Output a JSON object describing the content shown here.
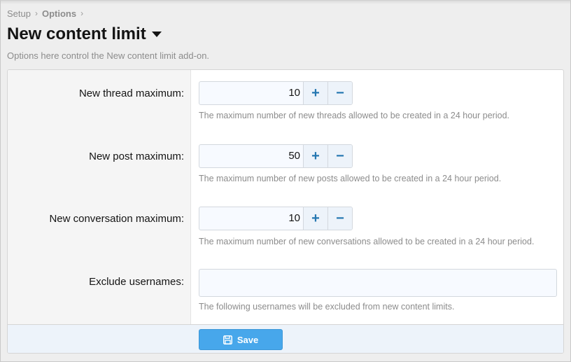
{
  "breadcrumb": {
    "items": [
      {
        "label": "Setup"
      },
      {
        "label": "Options"
      }
    ],
    "separator": "›"
  },
  "header": {
    "title": "New content limit",
    "description": "Options here control the New content limit add-on."
  },
  "form": {
    "rows": [
      {
        "label": "New thread maximum:",
        "value": "10",
        "hint": "The maximum number of new threads allowed to be created in a 24 hour period."
      },
      {
        "label": "New post maximum:",
        "value": "50",
        "hint": "The maximum number of new posts allowed to be created in a 24 hour period."
      },
      {
        "label": "New conversation maximum:",
        "value": "10",
        "hint": "The maximum number of new conversations allowed to be created in a 24 hour period."
      }
    ],
    "exclude": {
      "label": "Exclude usernames:",
      "value": "",
      "hint": "The following usernames will be excluded from new content limits."
    },
    "increment_symbol": "+",
    "decrement_symbol": "−"
  },
  "footer": {
    "save_label": "Save"
  },
  "icons": {
    "save": "floppy-disk-icon",
    "title_caret": "caret-down-icon",
    "increment": "plus-icon",
    "decrement": "minus-icon"
  },
  "colors": {
    "accent": "#2577b1",
    "button": "#47a7eb",
    "footer_bg": "#edf3fa"
  }
}
